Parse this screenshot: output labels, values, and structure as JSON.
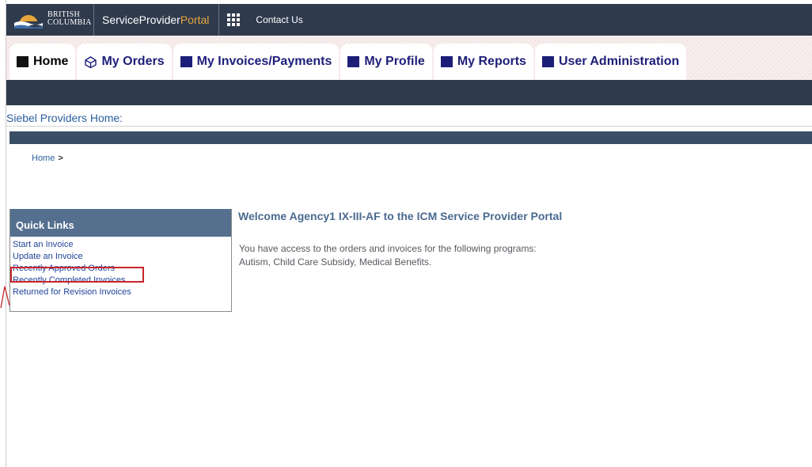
{
  "topbar": {
    "logo_line1": "British",
    "logo_line2": "Columbia",
    "portal_name_main": "ServiceProvider",
    "portal_name_accent": "Portal",
    "contact_link": "Contact Us"
  },
  "tabs": [
    {
      "label": "Home",
      "active": true
    },
    {
      "label": "My Orders"
    },
    {
      "label": "My Invoices/Payments"
    },
    {
      "label": "My Profile"
    },
    {
      "label": "My Reports"
    },
    {
      "label": "User Administration"
    }
  ],
  "page_heading": "Siebel Providers Home:",
  "breadcrumb": {
    "home": "Home",
    "separator": ">"
  },
  "quick_links": {
    "title": "Quick Links",
    "items": [
      "Start an Invoice",
      "Update an Invoice",
      "Recently Approved Orders",
      "Recently Completed Invoices",
      "Returned for Revision Invoices"
    ],
    "highlighted_item": "Recently Approved Orders"
  },
  "welcome": {
    "title": "Welcome Agency1 IX-III-AF to the ICM Service Provider Portal",
    "line1": "You have access to the orders and invoices for the following programs:",
    "line2": "Autism, Child Care Subsidy, Medical Benefits."
  },
  "colors": {
    "topbar_bg": "#2f3b4d",
    "tab_text": "#1d1e78",
    "link": "#21449a",
    "highlight_border": "#c9242b",
    "quick_links_header": "#55708f"
  }
}
